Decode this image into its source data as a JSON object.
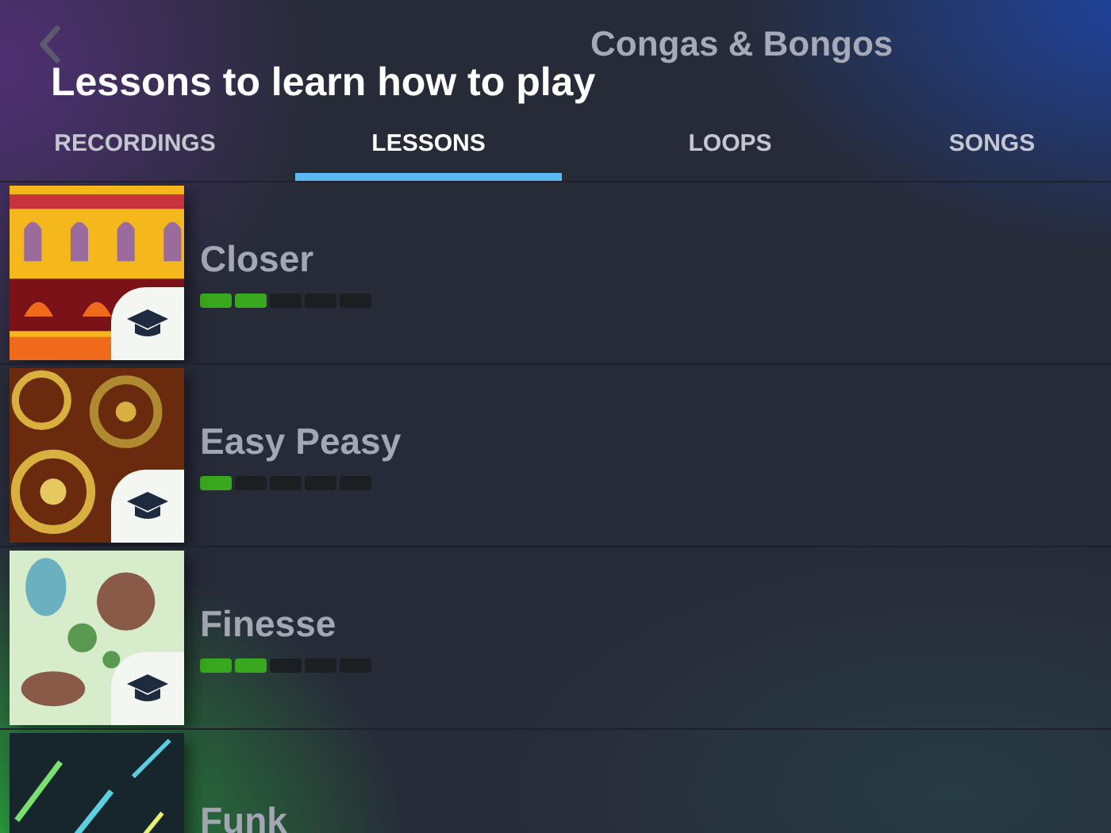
{
  "header": {
    "instrument": "Congas & Bongos",
    "heading": "Lessons to learn how to play"
  },
  "tabs": [
    {
      "label": "RECORDINGS",
      "selected": false
    },
    {
      "label": "LESSONS",
      "selected": true
    },
    {
      "label": "LOOPS",
      "selected": false
    },
    {
      "label": "SONGS",
      "selected": false
    }
  ],
  "lessons": [
    {
      "title": "Closer",
      "level": 0.4,
      "lesson_badge": true
    },
    {
      "title": "Easy Peasy",
      "level": 0.2,
      "lesson_badge": true
    },
    {
      "title": "Finesse",
      "level": 0.4,
      "lesson_badge": true
    },
    {
      "title": "Funk"
    }
  ]
}
